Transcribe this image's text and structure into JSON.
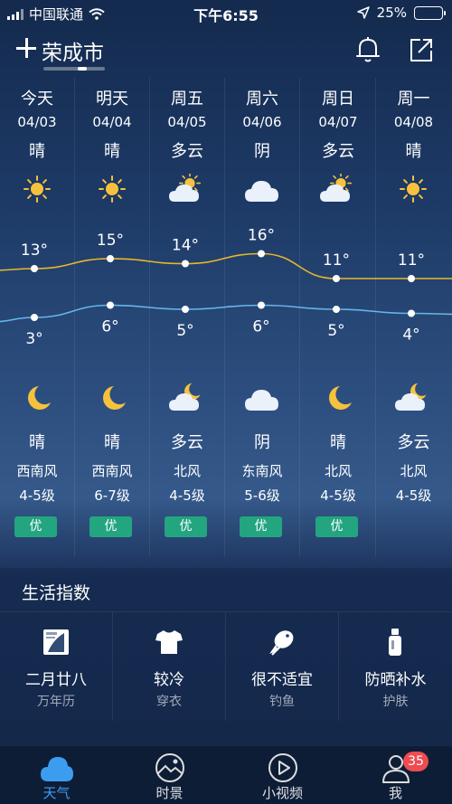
{
  "status_bar": {
    "carrier": "中国联通",
    "time": "下午6:55",
    "battery_percent": "25%",
    "battery_level": 0.25,
    "icons": [
      "signal-icon",
      "wifi-icon",
      "location-arrow-icon",
      "battery-icon"
    ]
  },
  "header": {
    "city": "荣成市",
    "icons": [
      "add-icon",
      "bell-icon",
      "share-icon"
    ]
  },
  "forecast": {
    "days": [
      {
        "name": "今天",
        "date": "04/03",
        "day_cond": "晴",
        "day_icon": "sun-icon",
        "high": "13°",
        "low": "3°",
        "night_icon": "moon-icon",
        "night_cond": "晴",
        "wind_dir": "西南风",
        "wind_level": "4-5级",
        "aqi": "优"
      },
      {
        "name": "明天",
        "date": "04/04",
        "day_cond": "晴",
        "day_icon": "sun-icon",
        "high": "15°",
        "low": "6°",
        "night_icon": "moon-icon",
        "night_cond": "晴",
        "wind_dir": "西南风",
        "wind_level": "6-7级",
        "aqi": "优"
      },
      {
        "name": "周五",
        "date": "04/05",
        "day_cond": "多云",
        "day_icon": "sun-cloud-icon",
        "high": "14°",
        "low": "5°",
        "night_icon": "moon-cloud-icon",
        "night_cond": "多云",
        "wind_dir": "北风",
        "wind_level": "4-5级",
        "aqi": "优"
      },
      {
        "name": "周六",
        "date": "04/06",
        "day_cond": "阴",
        "day_icon": "cloud-icon",
        "high": "16°",
        "low": "6°",
        "night_icon": "cloud-icon",
        "night_cond": "阴",
        "wind_dir": "东南风",
        "wind_level": "5-6级",
        "aqi": "优"
      },
      {
        "name": "周日",
        "date": "04/07",
        "day_cond": "多云",
        "day_icon": "sun-cloud-icon",
        "high": "11°",
        "low": "5°",
        "night_icon": "moon-icon",
        "night_cond": "晴",
        "wind_dir": "北风",
        "wind_level": "4-5级",
        "aqi": "优"
      },
      {
        "name": "周一",
        "date": "04/08",
        "day_cond": "晴",
        "day_icon": "sun-icon",
        "high": "11°",
        "low": "4°",
        "night_icon": "moon-cloud-icon",
        "night_cond": "多云",
        "wind_dir": "北风",
        "wind_level": "4-5级",
        "aqi": ""
      }
    ],
    "high_temps": [
      13,
      15,
      14,
      16,
      11,
      11
    ],
    "low_temps": [
      3,
      6,
      5,
      6,
      5,
      4
    ],
    "high_line_color": "#e7b72c",
    "low_line_color": "#66b6ea"
  },
  "life_index": {
    "title": "生活指数",
    "items": [
      {
        "value": "二月廿八",
        "name": "万年历",
        "icon": "calendar-icon"
      },
      {
        "value": "较冷",
        "name": "穿衣",
        "icon": "shirt-icon"
      },
      {
        "value": "很不适宜",
        "name": "钓鱼",
        "icon": "fish-icon"
      },
      {
        "value": "防晒补水",
        "name": "护肤",
        "icon": "lotion-icon"
      }
    ]
  },
  "tabbar": {
    "tabs": [
      {
        "label": "天气",
        "icon": "cloud-tab-icon",
        "active": true
      },
      {
        "label": "时景",
        "icon": "scene-tab-icon",
        "active": false
      },
      {
        "label": "小视频",
        "icon": "video-tab-icon",
        "active": false
      },
      {
        "label": "我",
        "icon": "profile-tab-icon",
        "active": false
      }
    ],
    "badge": "35",
    "active_color": "#3c9df0",
    "badge_color": "#ee4c50"
  }
}
